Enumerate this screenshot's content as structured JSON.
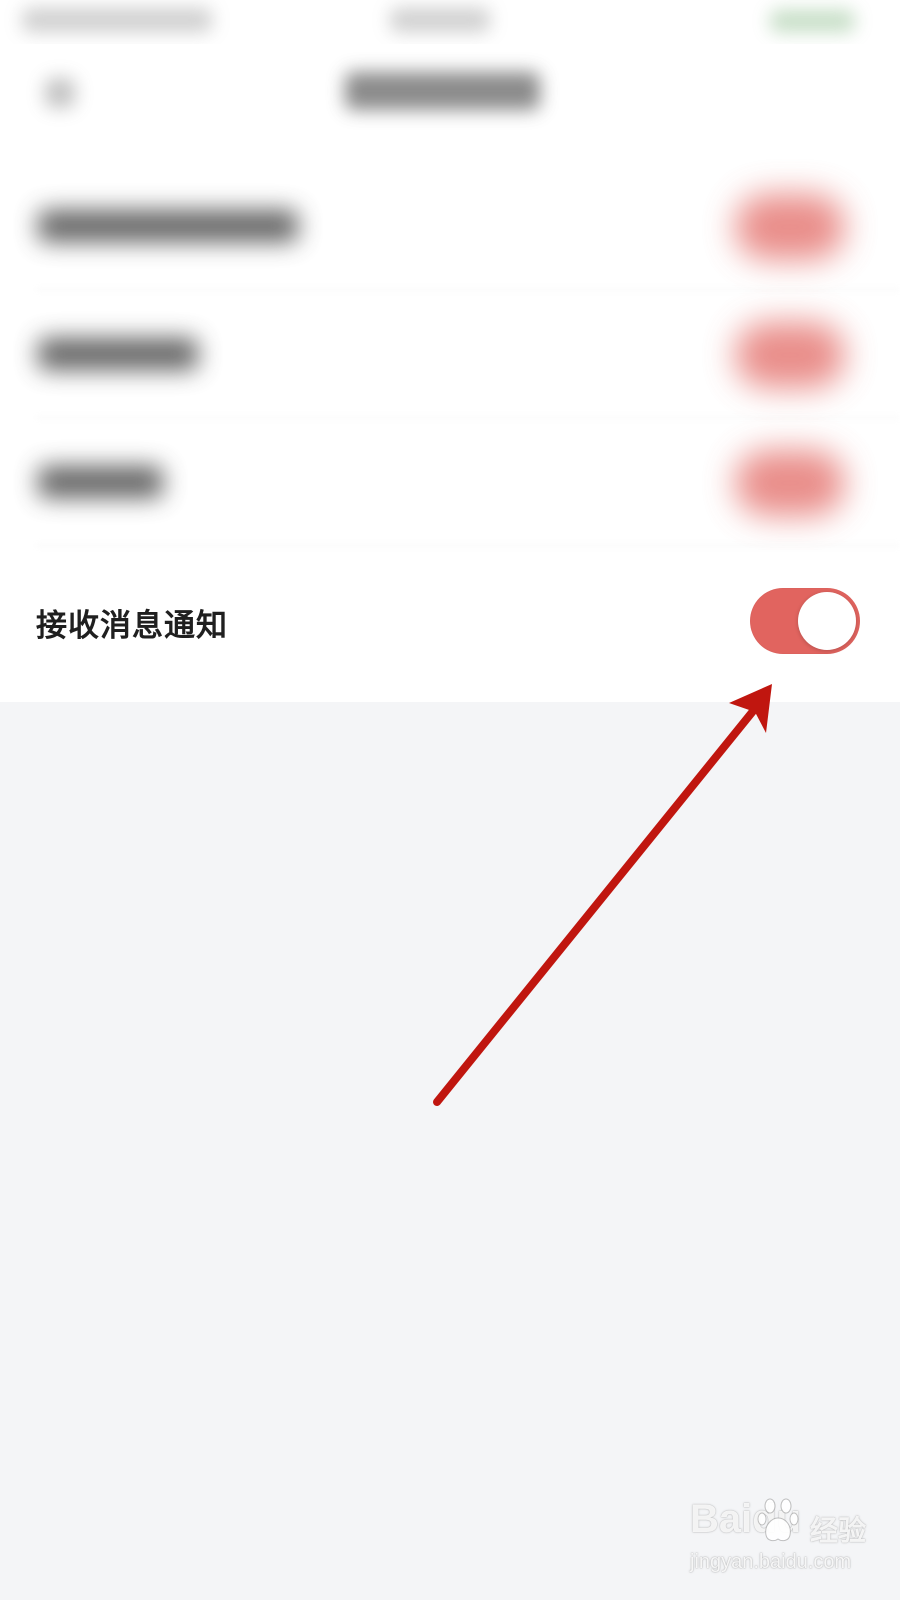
{
  "settings": {
    "items": [
      {
        "label": "",
        "toggle_on": true,
        "blurred": true
      },
      {
        "label": "",
        "toggle_on": true,
        "blurred": true
      },
      {
        "label": "",
        "toggle_on": true,
        "blurred": true
      },
      {
        "label": "接收消息通知",
        "toggle_on": true,
        "blurred": false
      }
    ]
  },
  "colors": {
    "toggle_active": "#e1645f",
    "annotation_arrow": "#c0160f",
    "page_background": "#f4f5f7",
    "panel_background": "#ffffff"
  },
  "icons": {
    "annotation": "arrow-annotation-icon",
    "watermark_paw": "paw-icon"
  },
  "watermark": {
    "brand": "Baidu",
    "text": "经验",
    "url": "jingyan.baidu.com"
  }
}
